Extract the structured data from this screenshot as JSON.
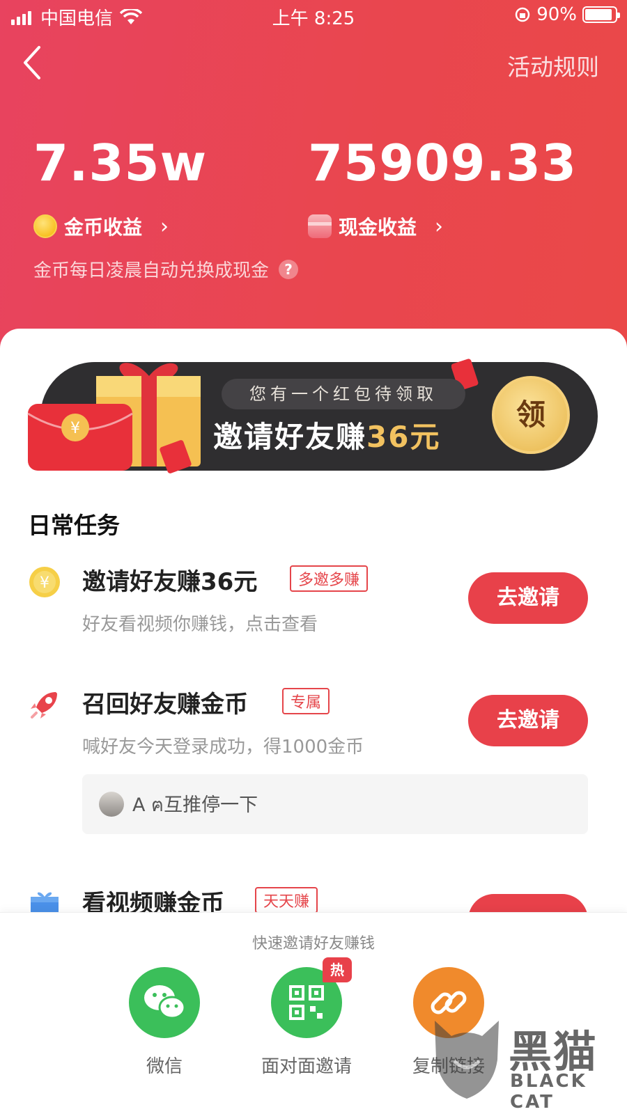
{
  "status_bar": {
    "carrier": "中国电信",
    "time": "上午 8:25",
    "battery": "90%"
  },
  "header": {
    "rules_label": "活动规则",
    "coin_value": "7.35w",
    "cash_value": "75909.33",
    "coin_label": "金币收益",
    "cash_label": "现金收益",
    "note": "金币每日凌晨自动兑换成现金",
    "chevron": "›",
    "help": "?"
  },
  "banner": {
    "subtitle": "您有一个红包待领取",
    "title_prefix": "邀请好友赚",
    "title_amount": "36元",
    "claim_label": "领"
  },
  "daily_tasks": {
    "section_title": "日常任务",
    "items": [
      {
        "title": "邀请好友赚36元",
        "tag": "多邀多赚",
        "desc": "好友看视频你赚钱，点击查看",
        "button": "去邀请",
        "icon": "coin-icon"
      },
      {
        "title": "召回好友赚金币",
        "tag": "专属",
        "desc": "喊好友今天登录成功，得1000金币",
        "button": "去邀请",
        "icon": "rocket-icon"
      },
      {
        "title": "看视频赚金币",
        "tag": "天天赚",
        "icon": "gift-icon"
      }
    ],
    "ticker_text": "A ฅ互推停一下"
  },
  "share_sheet": {
    "title": "快速邀请好友赚钱",
    "options": [
      {
        "label": "微信",
        "icon": "wechat-icon",
        "color": "#3bbf5a"
      },
      {
        "label": "面对面邀请",
        "icon": "qrcode-icon",
        "color": "#3bbf5a",
        "badge": "热"
      },
      {
        "label": "复制链接",
        "icon": "link-icon",
        "color": "#f08a2c"
      }
    ]
  },
  "watermark": {
    "text": "黑猫",
    "sub": "BLACK CAT"
  },
  "colors": {
    "header_red": "#e9464f",
    "accent_red": "#e8414a",
    "gold": "#f2c260"
  }
}
